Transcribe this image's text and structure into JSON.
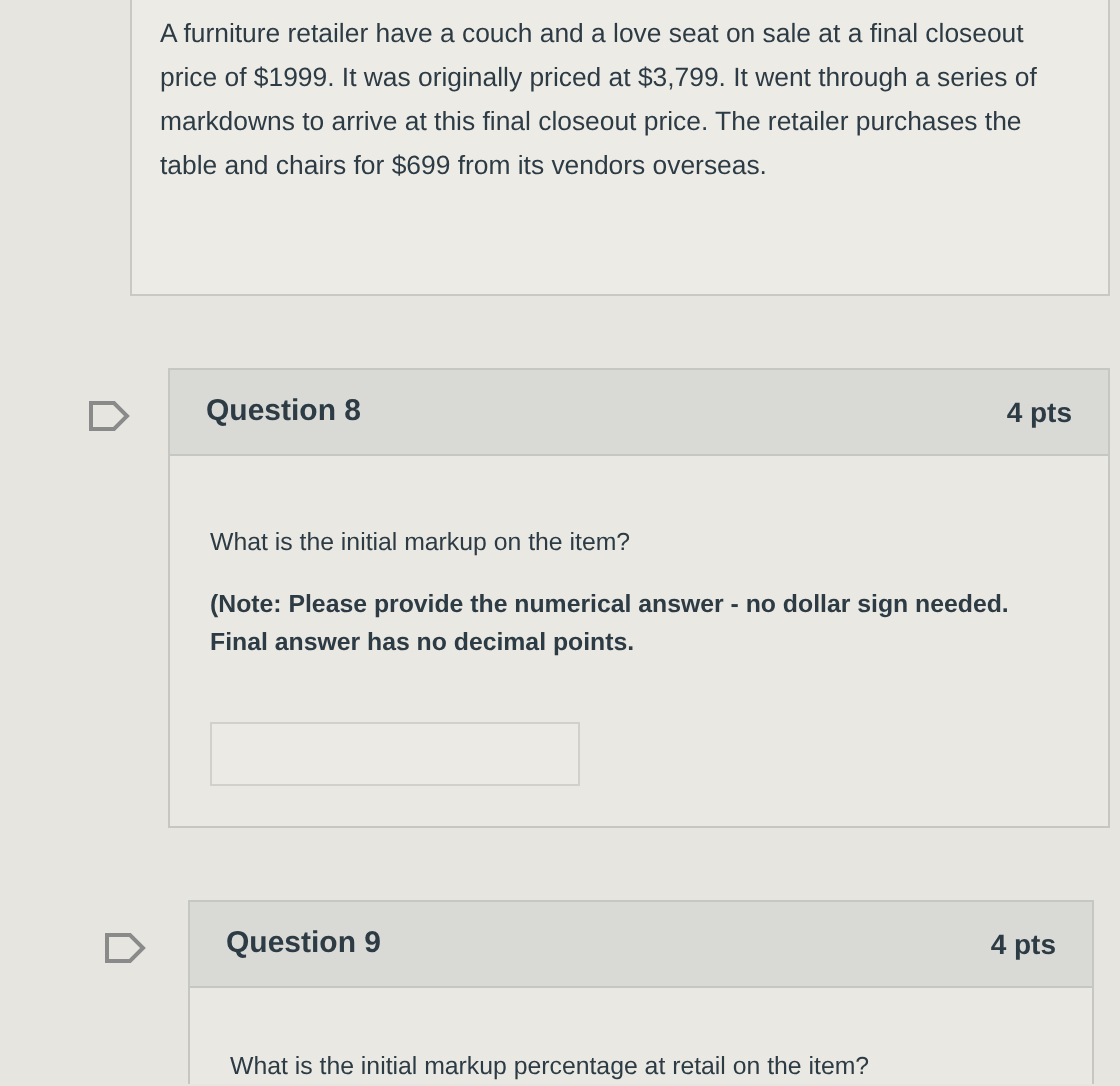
{
  "intro": {
    "text": "A furniture retailer have a couch and a love seat on sale at a final closeout price of $1999. It was originally priced at $3,799. It went through a series of markdowns to arrive at this final closeout price. The retailer purchases the table and chairs for $699 from its vendors overseas."
  },
  "questions": [
    {
      "title": "Question 8",
      "points": "4 pts",
      "paragraphs": [
        {
          "text": "What is the initial markup on the item?",
          "bold": false
        },
        {
          "text": "(Note: Please provide the numerical answer - no dollar sign needed. Final answer has no decimal points.",
          "bold": true
        }
      ],
      "answer_field": true
    },
    {
      "title": "Question 9",
      "points": "4 pts",
      "paragraphs": [
        {
          "text": "What is the initial markup percentage at retail on the item?",
          "bold": false
        }
      ]
    }
  ]
}
